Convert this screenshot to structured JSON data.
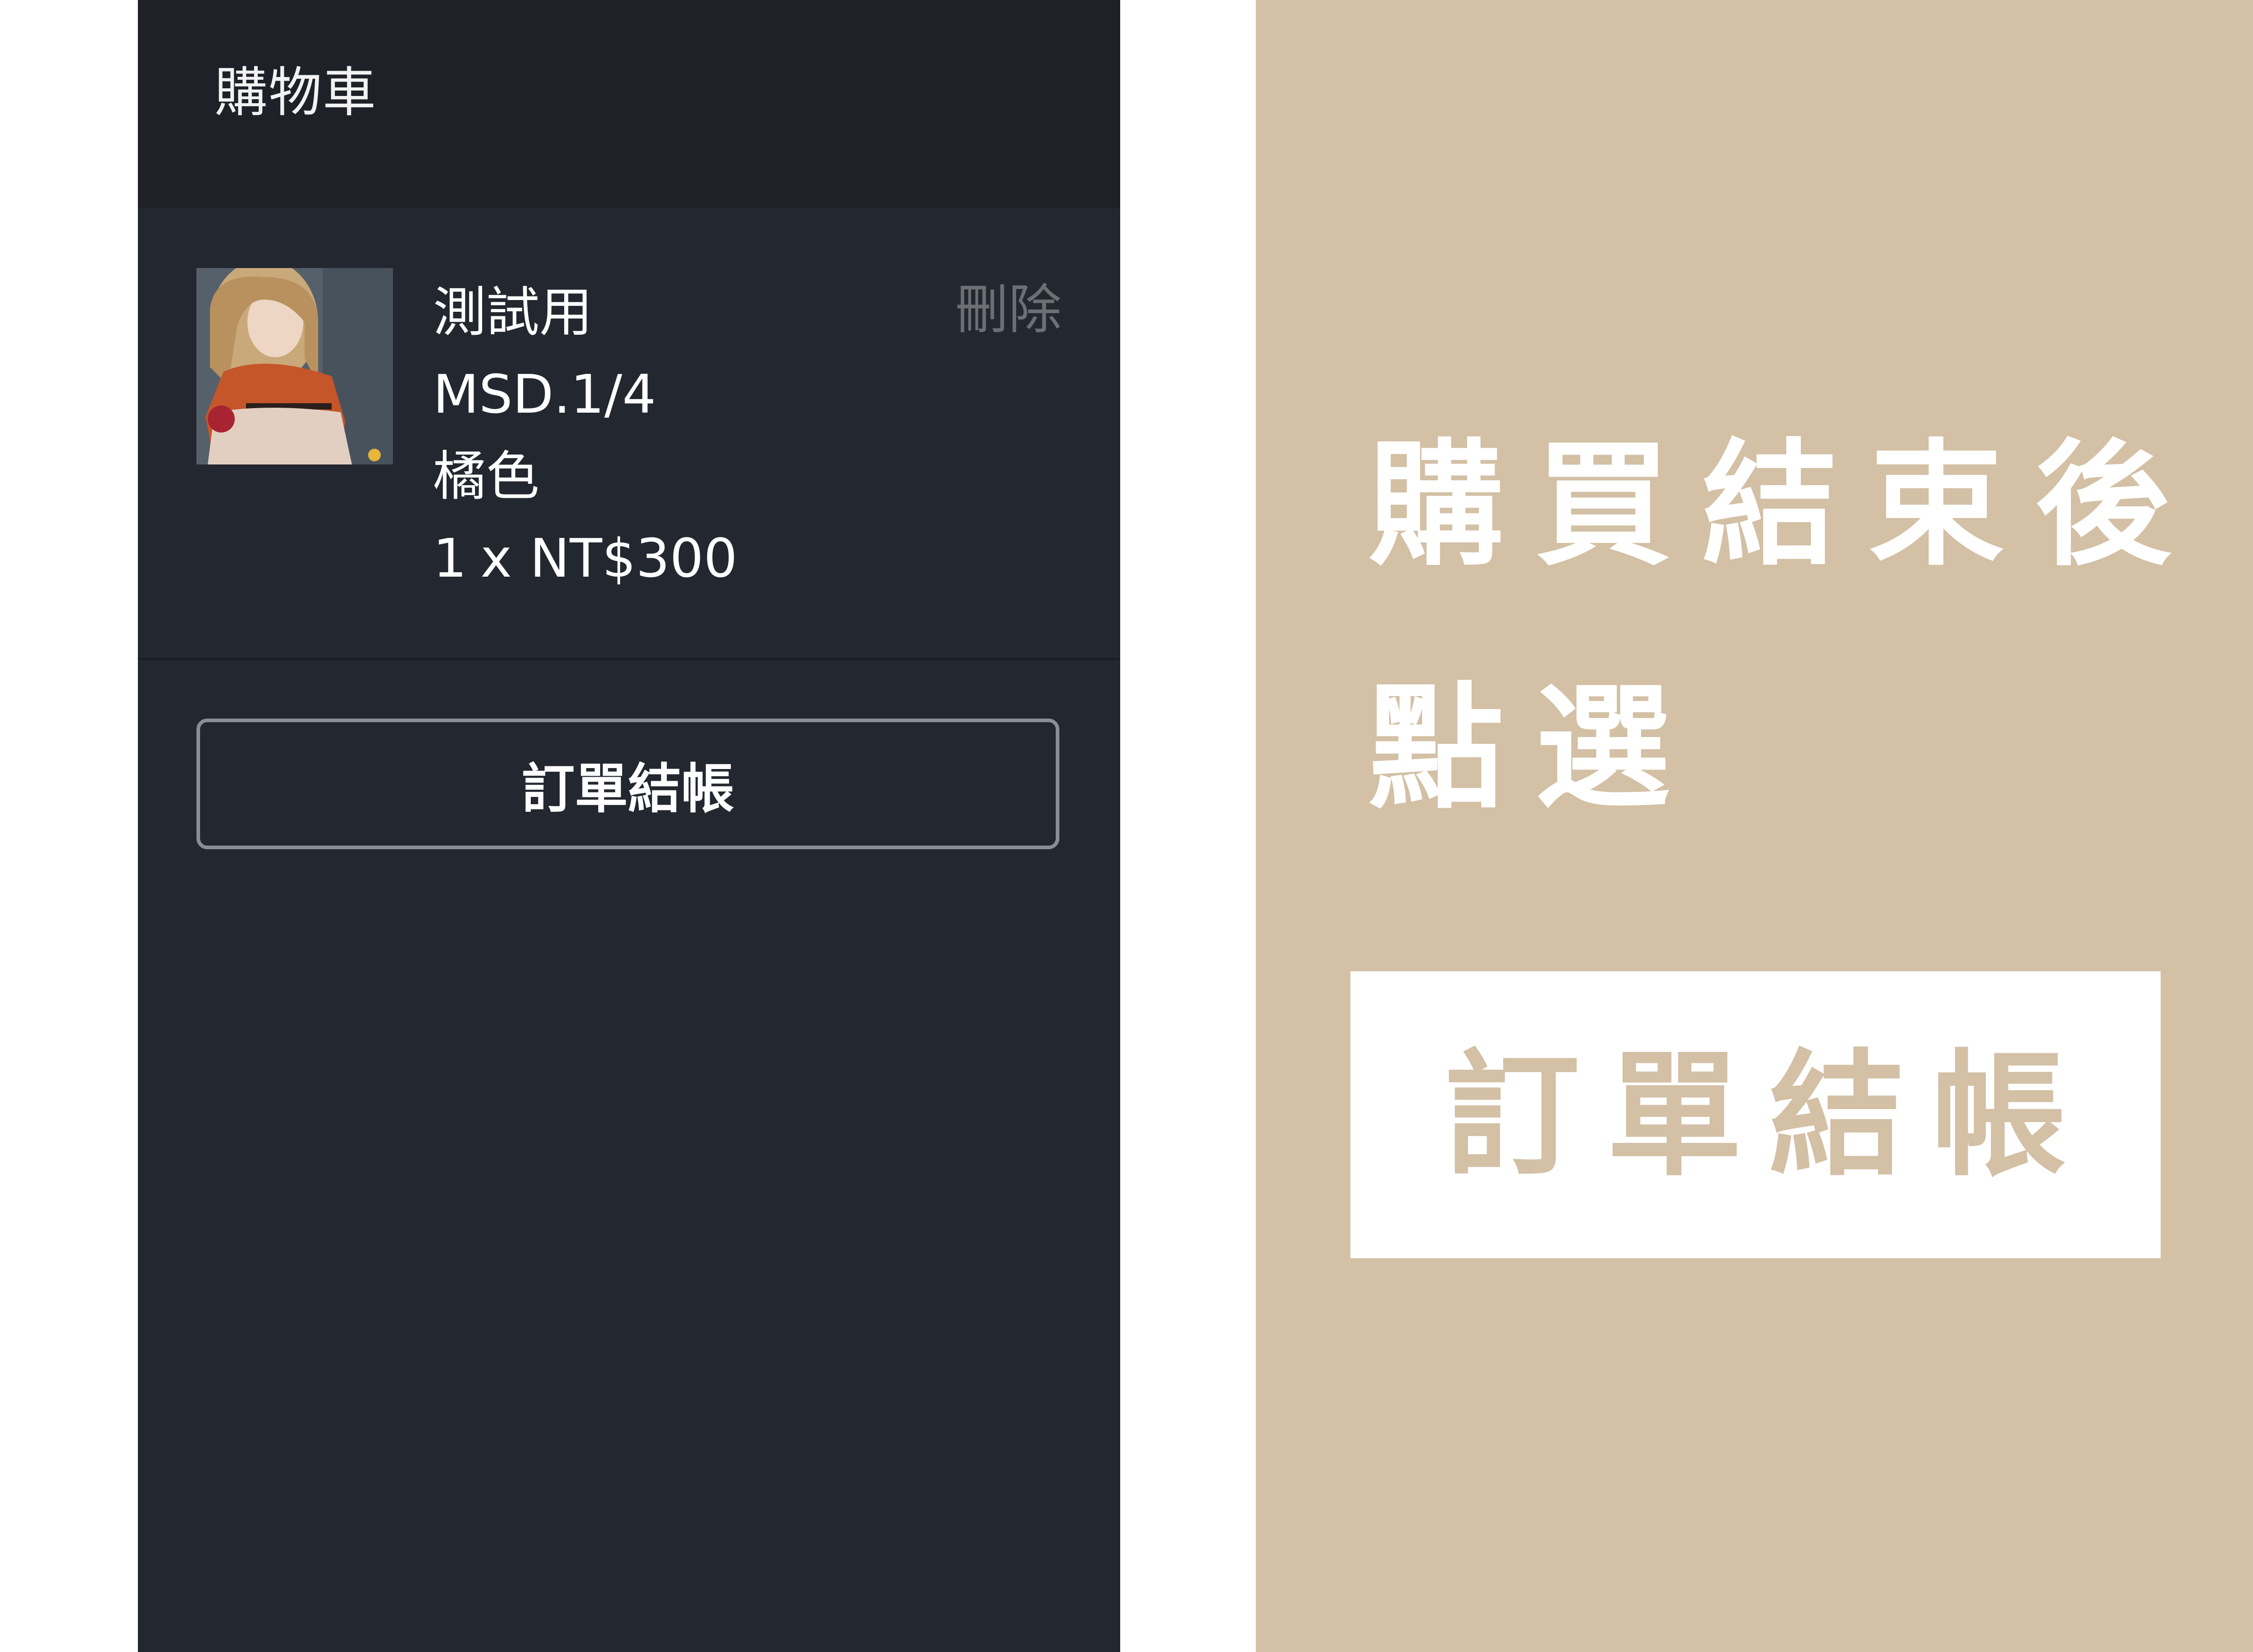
{
  "cart": {
    "title": "購物車",
    "item": {
      "name": "測試用",
      "spec": "MSD.1/4",
      "color": "橘色",
      "quantity": "1",
      "qty_sep": "x",
      "price": "NT$300",
      "delete_label": "刪除",
      "image_icon": "doll-product-photo"
    },
    "checkout_label": "訂單結帳"
  },
  "instruction": {
    "line1": "購買結束後",
    "line2": "點選",
    "callout": "訂單結帳"
  },
  "colors": {
    "panel_bg": "#232830",
    "header_bg": "#1e2228",
    "accent_tan": "#d3c0a5",
    "muted_text": "#6c6f74"
  }
}
